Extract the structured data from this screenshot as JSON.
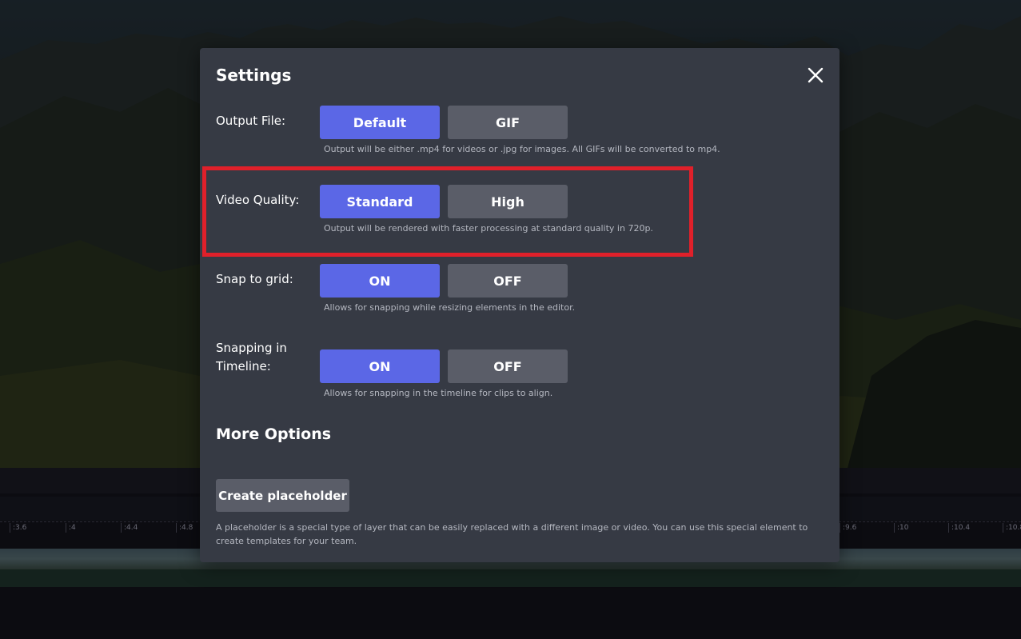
{
  "dialog": {
    "title": "Settings",
    "close_icon": "close-icon"
  },
  "settings": {
    "output_file": {
      "label": "Output File:",
      "options": [
        "Default",
        "GIF"
      ],
      "selected": "Default",
      "hint": "Output will be either .mp4 for videos or .jpg for images. All GIFs will be converted to mp4."
    },
    "video_quality": {
      "label": "Video Quality:",
      "options": [
        "Standard",
        "High"
      ],
      "selected": "Standard",
      "hint": "Output will be rendered with faster processing at standard quality in 720p."
    },
    "snap_to_grid": {
      "label": "Snap to grid:",
      "options": [
        "ON",
        "OFF"
      ],
      "selected": "ON",
      "hint": "Allows for snapping while resizing elements in the editor."
    },
    "snapping_timeline": {
      "label": "Snapping in Timeline:",
      "options": [
        "ON",
        "OFF"
      ],
      "selected": "ON",
      "hint": "Allows for snapping in the timeline for clips to align."
    }
  },
  "more_options": {
    "title": "More Options",
    "placeholder_button": "Create placeholder",
    "placeholder_description": "A placeholder is a special type of layer that can be easily replaced with a different image or video. You can use this special element to create templates for your team."
  },
  "timeline": {
    "ticks_left": [
      ":3.6",
      ":4",
      ":4.4",
      ":4.8"
    ],
    "ticks_right": [
      ":9.6",
      ":10",
      ":10.4",
      ":10.8"
    ]
  },
  "colors": {
    "active_button": "#5b67e6",
    "inactive_button": "#5a5d68",
    "modal_background": "#363a44",
    "highlight_border": "#e0202a"
  }
}
